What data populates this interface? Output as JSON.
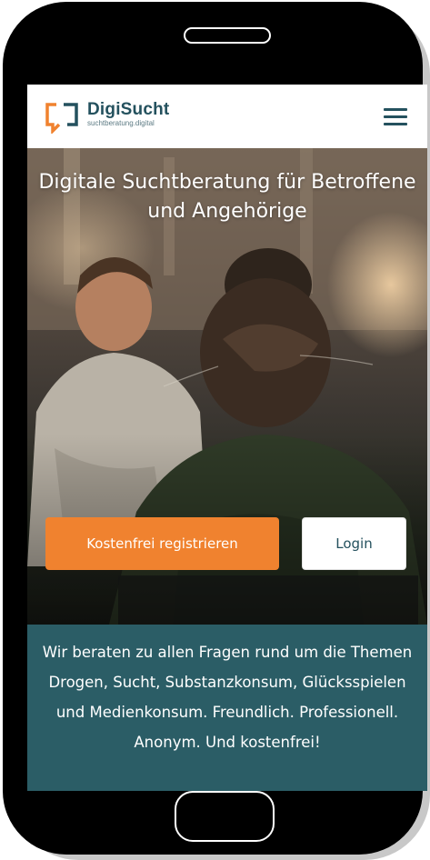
{
  "header": {
    "brand_name": "DigiSucht",
    "brand_tagline": "suchtberatung.digital",
    "logo_icon": "chat-bubble-bracket-icon",
    "menu_icon": "hamburger-menu-icon"
  },
  "hero": {
    "title": "Digitale Suchtberatung für Betroffene und Angehörige",
    "register_label": "Kostenfrei registrieren",
    "login_label": "Login"
  },
  "info": {
    "text": "Wir beraten zu allen Fragen rund um die Themen Drogen, Sucht, Substanzkonsum, Glücksspielen und Medienkonsum. Freundlich. Professionell. Anonym. Und kostenfrei!"
  },
  "colors": {
    "brand_dark": "#24515e",
    "accent_orange": "#f0822f",
    "info_band": "#2b5d66"
  }
}
